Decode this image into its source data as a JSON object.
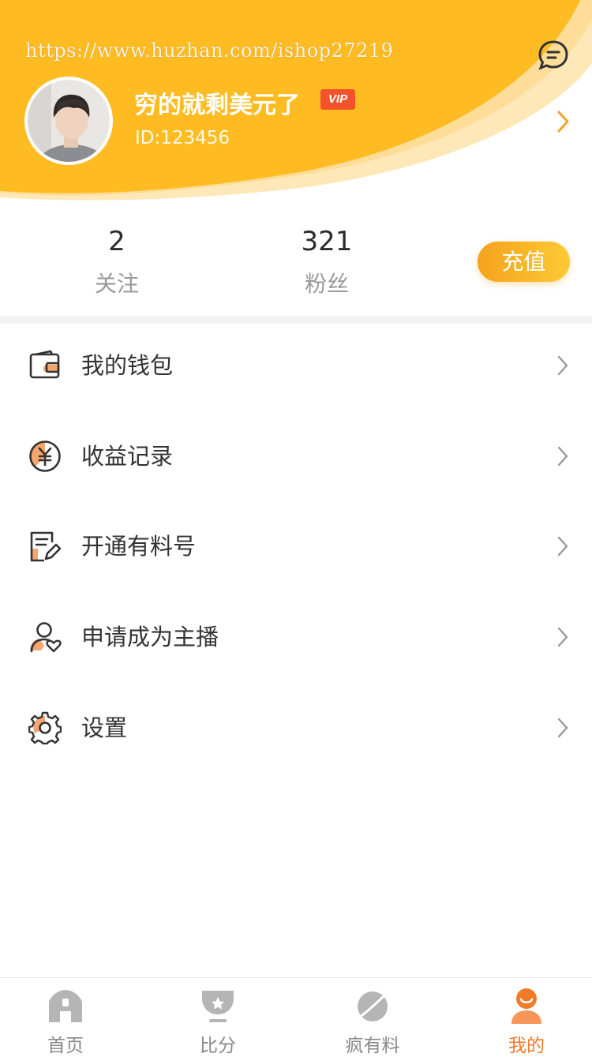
{
  "header": {
    "watermark": "https://www.huzhan.com/ishop27219",
    "username": "穷的就剩美元了",
    "vip_badge": "VIP",
    "user_id": "ID:123456"
  },
  "stats": {
    "following": {
      "value": "2",
      "label": "关注"
    },
    "fans": {
      "value": "321",
      "label": "粉丝"
    },
    "recharge_label": "充值"
  },
  "menu": [
    {
      "label": "我的钱包",
      "icon": "wallet-icon"
    },
    {
      "label": "收益记录",
      "icon": "yen-coin-icon"
    },
    {
      "label": "开通有料号",
      "icon": "edit-document-icon"
    },
    {
      "label": "申请成为主播",
      "icon": "user-heart-icon"
    },
    {
      "label": "设置",
      "icon": "gear-icon"
    }
  ],
  "tabs": [
    {
      "label": "首页",
      "icon": "home-icon",
      "active": false
    },
    {
      "label": "比分",
      "icon": "trophy-icon",
      "active": false
    },
    {
      "label": "疯有料",
      "icon": "planet-icon",
      "active": false
    },
    {
      "label": "我的",
      "icon": "user-icon",
      "active": true
    }
  ],
  "colors": {
    "brand_yellow": "#ffbc22",
    "accent_orange": "#f07a28",
    "icon_peach": "#f5a56e"
  }
}
